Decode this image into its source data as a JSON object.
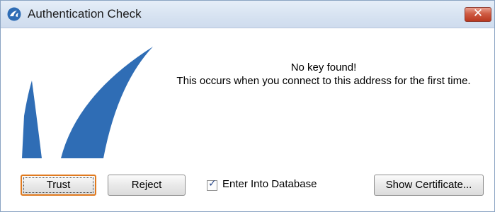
{
  "window": {
    "title": "Authentication Check",
    "close_glyph": "✕"
  },
  "message": {
    "line1": "No key found!",
    "line2": "This occurs when you connect to this address for the first time."
  },
  "buttons": {
    "trust": "Trust",
    "reject": "Reject",
    "show_certificate": "Show Certificate..."
  },
  "checkbox": {
    "label": "Enter Into Database",
    "checked": true,
    "check_glyph": "✓"
  },
  "icons": {
    "app": "barracuda-logo-icon",
    "logo": "barracuda-shark-fin-logo"
  },
  "colors": {
    "logo_blue": "#2f6db5",
    "focus_orange": "#e07a1f",
    "close_red": "#c94a31"
  }
}
